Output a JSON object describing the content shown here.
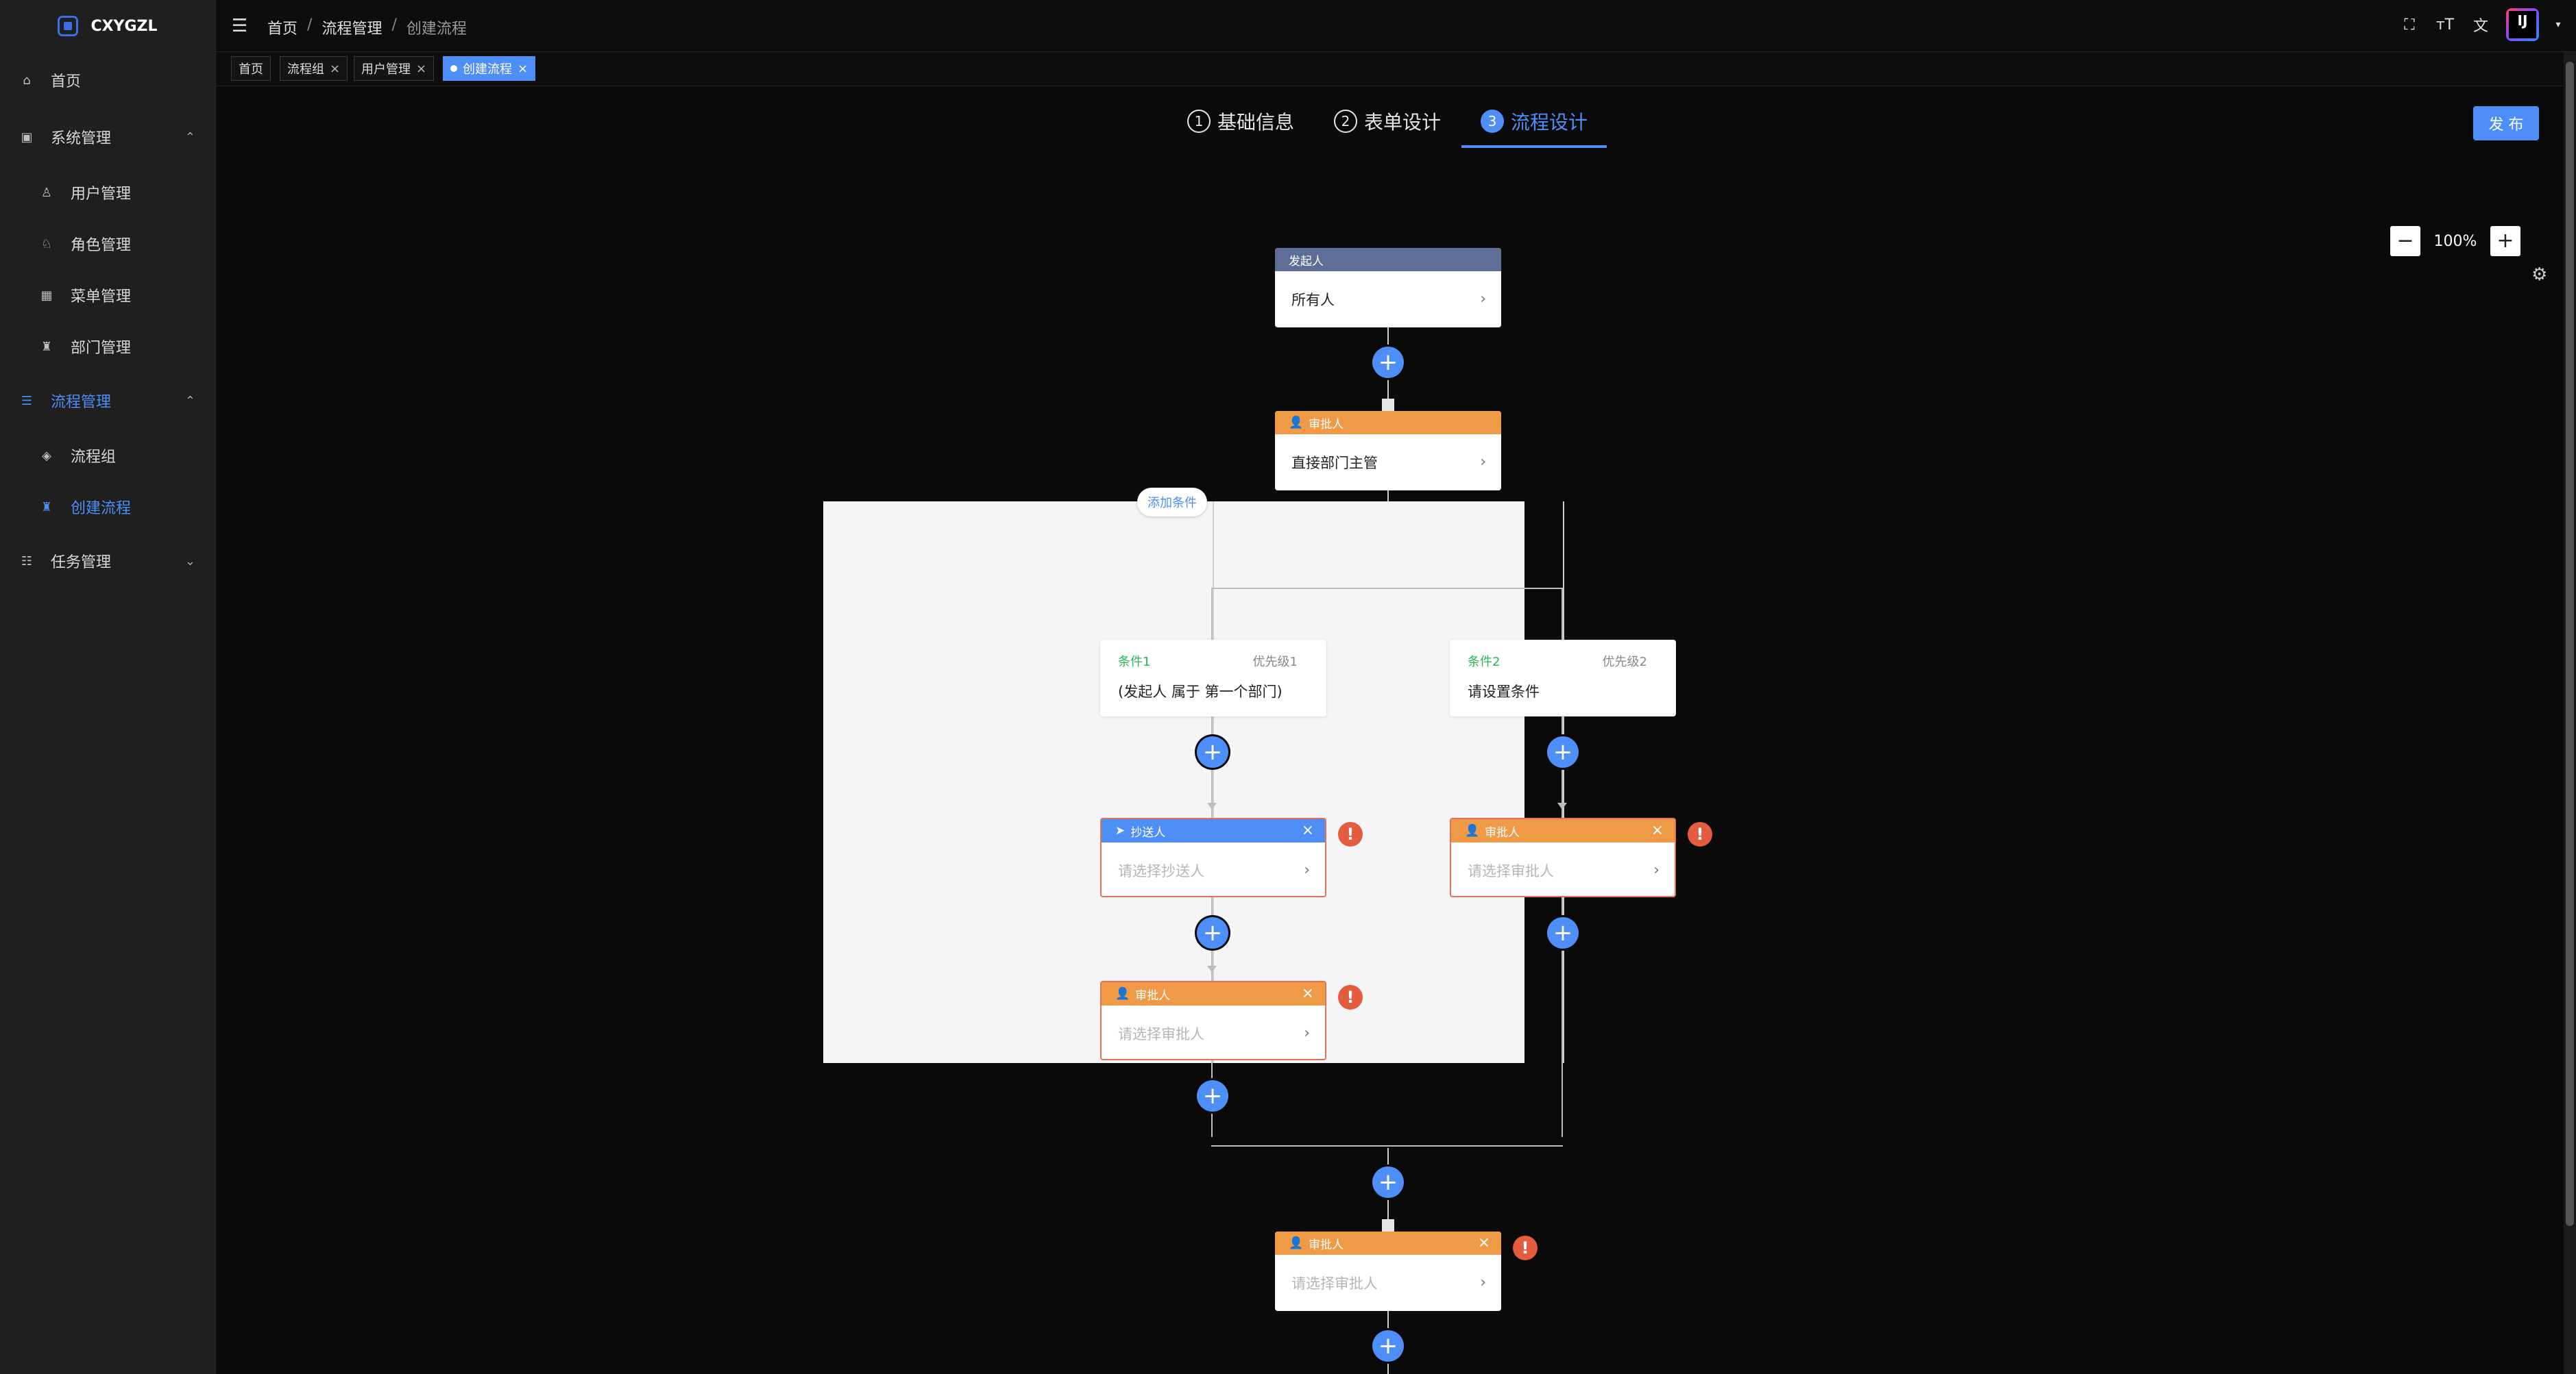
{
  "app": {
    "logo_text": "CXYGZL"
  },
  "sidebar": {
    "items": [
      {
        "label": "首页",
        "icon": "home-icon"
      },
      {
        "label": "系统管理",
        "icon": "system-icon",
        "arrow": "⌃"
      },
      {
        "label": "用户管理",
        "icon": "user-icon"
      },
      {
        "label": "角色管理",
        "icon": "role-icon"
      },
      {
        "label": "菜单管理",
        "icon": "menu-icon"
      },
      {
        "label": "部门管理",
        "icon": "department-icon"
      },
      {
        "label": "流程管理",
        "icon": "process-icon",
        "arrow": "⌃"
      },
      {
        "label": "流程组",
        "icon": "process-group-icon"
      },
      {
        "label": "创建流程",
        "icon": "create-process-icon"
      },
      {
        "label": "任务管理",
        "icon": "task-icon",
        "arrow": "⌄"
      }
    ]
  },
  "header": {
    "breadcrumb": [
      "首页",
      "流程管理",
      "创建流程"
    ],
    "avatar_text": "IJ"
  },
  "tabs": [
    {
      "label": "首页"
    },
    {
      "label": "流程组"
    },
    {
      "label": "用户管理"
    },
    {
      "label": "创建流程"
    }
  ],
  "steps": [
    {
      "num": "1",
      "label": "基础信息"
    },
    {
      "num": "2",
      "label": "表单设计"
    },
    {
      "num": "3",
      "label": "流程设计"
    }
  ],
  "publish_label": "发 布",
  "zoom": {
    "value": "100%"
  },
  "flow": {
    "start": {
      "title": "发起人",
      "content": "所有人"
    },
    "approver1": {
      "title": "审批人",
      "content": "直接部门主管"
    },
    "add_condition": "添加条件",
    "conditions": [
      {
        "name": "条件1",
        "priority": "优先级1",
        "desc": "(发起人 属于 第一个部门)"
      },
      {
        "name": "条件2",
        "priority": "优先级2",
        "desc": "请设置条件"
      }
    ],
    "cc_node": {
      "title": "抄送人",
      "placeholder": "请选择抄送人"
    },
    "branch1_approver": {
      "title": "审批人",
      "placeholder": "请选择审批人"
    },
    "branch2_approver": {
      "title": "审批人",
      "placeholder": "请选择审批人"
    },
    "final_approver": {
      "title": "审批人",
      "placeholder": "请选择审批人"
    }
  },
  "colors": {
    "accent": "#4e8ef7",
    "approver": "#ef9a46",
    "start": "#5d6d96",
    "error": "#e35c3d",
    "condition": "#2eb55a"
  }
}
